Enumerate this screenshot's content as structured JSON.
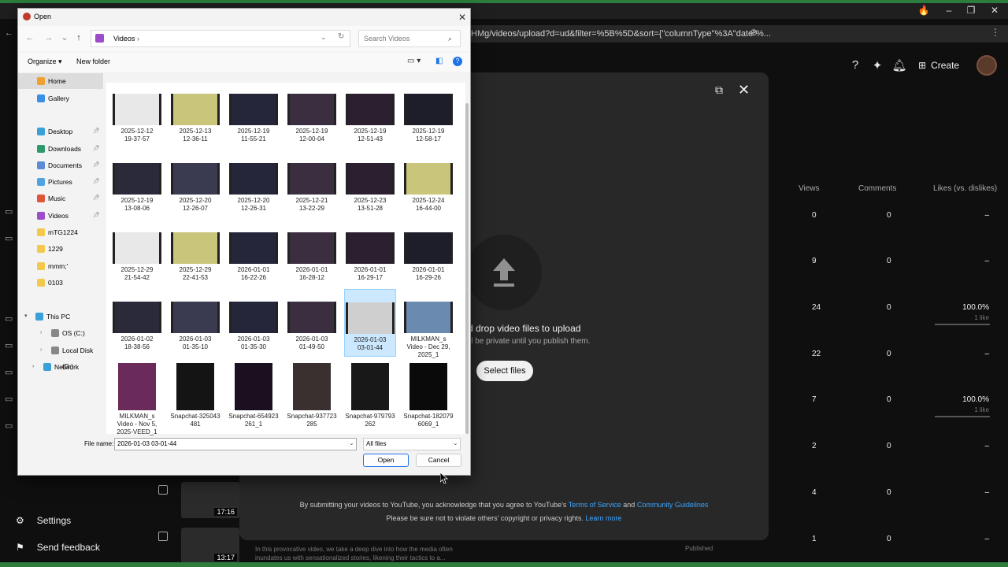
{
  "dialog": {
    "title": "Open",
    "path": "Videos",
    "search_placeholder": "Search Videos",
    "organize": "Organize",
    "new_folder": "New folder",
    "nav": [
      {
        "label": "Home",
        "color": "#f0a030",
        "pinned": false,
        "selected": true
      },
      {
        "label": "Gallery",
        "color": "#3a8ee6",
        "pinned": false,
        "selected": false
      },
      {
        "label": "Desktop",
        "color": "#3aa0d8",
        "pinned": true,
        "selected": false
      },
      {
        "label": "Downloads",
        "color": "#2e9a6a",
        "pinned": true,
        "selected": false
      },
      {
        "label": "Documents",
        "color": "#5b8bd6",
        "pinned": true,
        "selected": false
      },
      {
        "label": "Pictures",
        "color": "#4fa3e0",
        "pinned": true,
        "selected": false
      },
      {
        "label": "Music",
        "color": "#e0553a",
        "pinned": true,
        "selected": false
      },
      {
        "label": "Videos",
        "color": "#9b4dca",
        "pinned": true,
        "selected": false
      },
      {
        "label": "mTG1224",
        "color": "#f2c94c",
        "pinned": false,
        "selected": false
      },
      {
        "label": "1229",
        "color": "#f2c94c",
        "pinned": false,
        "selected": false
      },
      {
        "label": "mmm;'",
        "color": "#f2c94c",
        "pinned": false,
        "selected": false
      },
      {
        "label": "0103",
        "color": "#f2c94c",
        "pinned": false,
        "selected": false
      }
    ],
    "tree": [
      {
        "label": "This PC",
        "color": "#3aa0d8"
      },
      {
        "label": "OS (C:)",
        "color": "#888888"
      },
      {
        "label": "Local Disk (D:)",
        "color": "#888888"
      },
      {
        "label": "Network",
        "color": "#3aa0d8"
      }
    ],
    "files": [
      {
        "label": "2025-12-12\n19-37-57"
      },
      {
        "label": "2025-12-13\n12-36-11"
      },
      {
        "label": "2025-12-19\n11-55-21"
      },
      {
        "label": "2025-12-19\n12-00-04"
      },
      {
        "label": "2025-12-19\n12-51-43"
      },
      {
        "label": "2025-12-19\n12-58-17"
      },
      {
        "label": "2025-12-19\n13-08-06"
      },
      {
        "label": "2025-12-20\n12-26-07"
      },
      {
        "label": "2025-12-20\n12-26-31"
      },
      {
        "label": "2025-12-21\n13-22-29"
      },
      {
        "label": "2025-12-23\n13-51-28"
      },
      {
        "label": "2025-12-24\n16-44-00"
      },
      {
        "label": "2025-12-29\n21-54-42"
      },
      {
        "label": "2025-12-29\n22-41-53"
      },
      {
        "label": "2026-01-01\n16-22-26"
      },
      {
        "label": "2026-01-01\n16-28-12"
      },
      {
        "label": "2026-01-01\n16-29-17"
      },
      {
        "label": "2026-01-01\n16-29-26"
      },
      {
        "label": "2026-01-02\n18-38-56"
      },
      {
        "label": "2026-01-03\n01-35-10"
      },
      {
        "label": "2026-01-03\n01-35-30"
      },
      {
        "label": "2026-01-03\n01-49-50"
      },
      {
        "label": "2026-01-03\n03-01-44"
      },
      {
        "label": "MILKMAN_s\nVideo - Dec 29,\n2025_1"
      },
      {
        "label": "MILKMAN_s\nVideo - Nov 5,\n2025-VEED_1"
      },
      {
        "label": "Snapchat-325043\n481"
      },
      {
        "label": "Snapchat-654923\n261_1"
      },
      {
        "label": "Snapchat-937723\n285"
      },
      {
        "label": "Snapchat-979793\n262"
      },
      {
        "label": "Snapchat-182079\n6069_1"
      }
    ],
    "file_name_label": "File name:",
    "file_name_value": "2026-01-03 03-01-44",
    "file_type": "All files",
    "open_label": "Open",
    "cancel_label": "Cancel"
  },
  "browser": {
    "address": "HMg/videos/upload?d=ud&filter=%5B%5D&sort={\"columnType\"%3A\"date\"%..."
  },
  "youtube": {
    "create_label": "Create",
    "drop_title": "d drop video files to upload",
    "drop_sub": "ll be private until you publish them.",
    "select_files": "Select files",
    "legal_prefix": "By submitting your videos to YouTube, you acknowledge that you agree to YouTube's",
    "terms": "Terms of Service",
    "and": "and",
    "guidelines": "Community Guidelines",
    "legal2_prefix": "Please be sure not to violate others' copyright or privacy rights.",
    "learn_more": "Learn more",
    "columns": [
      "Views",
      "Comments",
      "Likes (vs. dislikes)"
    ],
    "rows": [
      {
        "views": "0",
        "comments": "0",
        "likes": "–",
        "sub": ""
      },
      {
        "views": "9",
        "comments": "0",
        "likes": "–",
        "sub": ""
      },
      {
        "views": "24",
        "comments": "0",
        "likes": "100.0%",
        "sub": "1 like"
      },
      {
        "views": "22",
        "comments": "0",
        "likes": "–",
        "sub": ""
      },
      {
        "views": "7",
        "comments": "0",
        "likes": "100.0%",
        "sub": "1 like"
      },
      {
        "views": "2",
        "comments": "0",
        "likes": "–",
        "sub": ""
      },
      {
        "views": "4",
        "comments": "0",
        "likes": "–",
        "sub": ""
      },
      {
        "views": "1",
        "comments": "0",
        "likes": "–",
        "sub": ""
      }
    ],
    "settings": "Settings",
    "send_feedback": "Send feedback",
    "durations": [
      "17:16",
      "13:17"
    ],
    "desc": "In this provocative video, we take a deep dive into how the media often\ninundates us with sensationalized stories, likening their tactics to a...",
    "published": "Published"
  }
}
